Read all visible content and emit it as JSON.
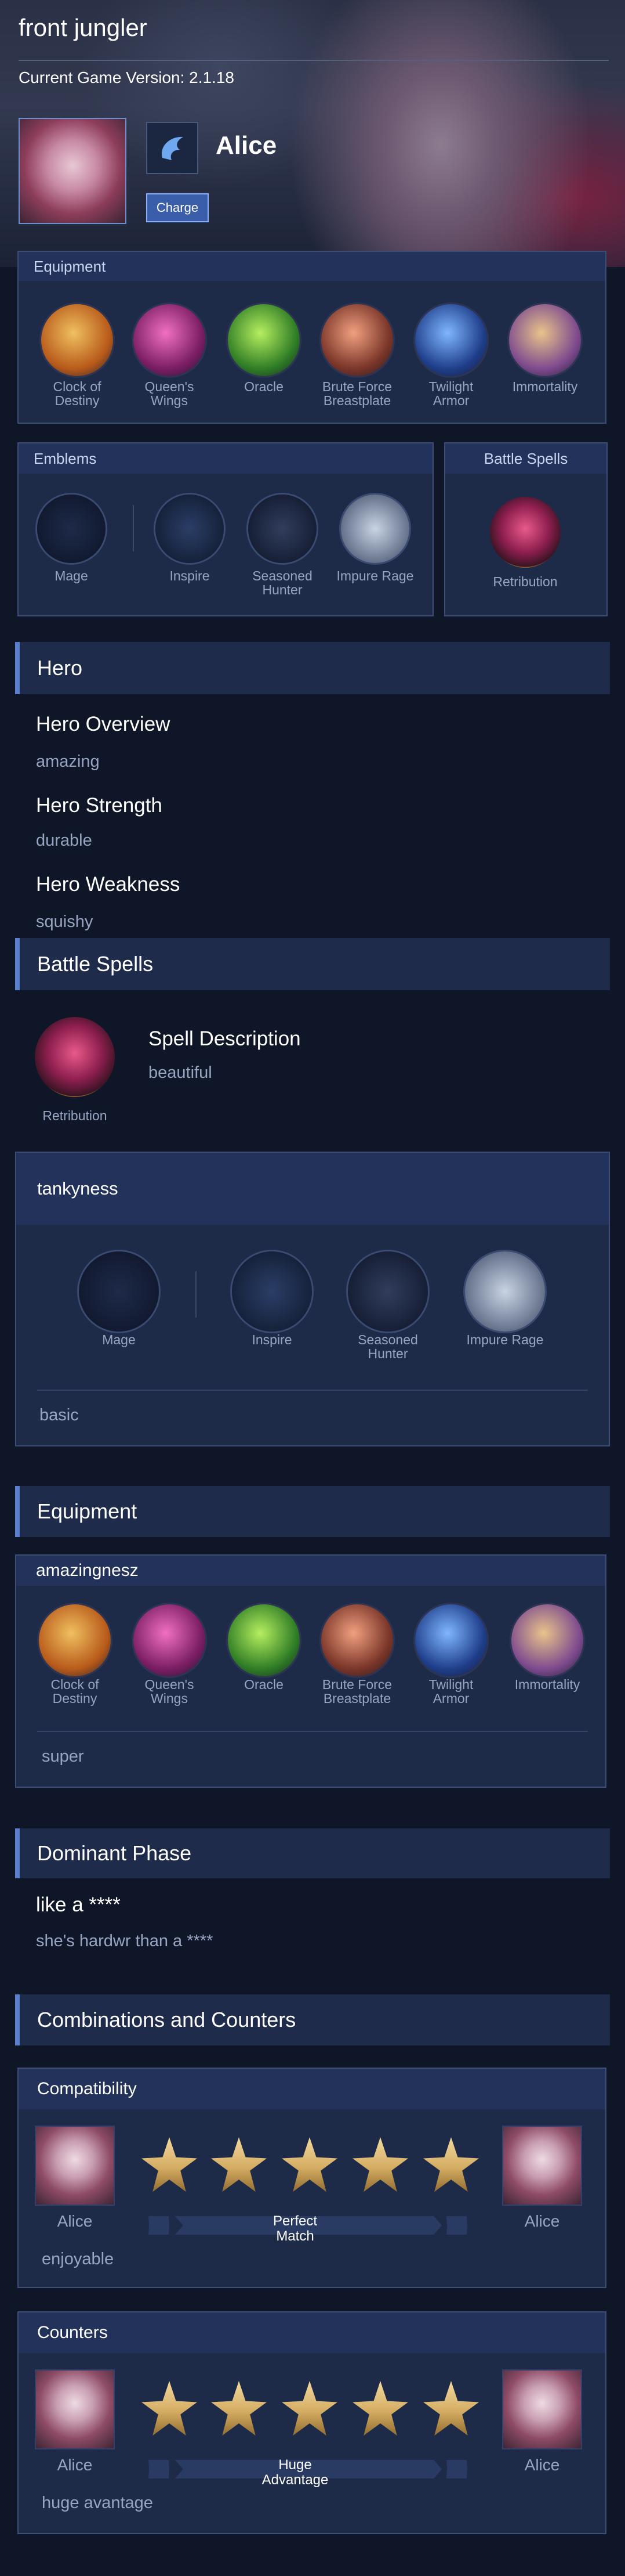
{
  "header": {
    "title": "front jungler",
    "version": "Current Game Version: 2.1.18",
    "hero_name": "Alice",
    "charge_label": "Charge"
  },
  "equipment_top": {
    "title": "Equipment",
    "items": [
      {
        "name": "Clock of\nDestiny",
        "color": "#d48a2a"
      },
      {
        "name": "Queen's\nWings",
        "color": "#c23a8e"
      },
      {
        "name": "Oracle",
        "color": "#5aa83a"
      },
      {
        "name": "Brute Force\nBreastplate",
        "color": "#b9593e"
      },
      {
        "name": "Twilight\nArmor",
        "color": "#3e6fc9"
      },
      {
        "name": "Immortality",
        "color": "#9a6fb0"
      }
    ]
  },
  "emblems_top": {
    "title": "Emblems",
    "items": [
      {
        "name": "Mage"
      },
      {
        "name": "Inspire"
      },
      {
        "name": "Seasoned\nHunter"
      },
      {
        "name": "Impure Rage"
      }
    ]
  },
  "battle_spells_top": {
    "title": "Battle Spells",
    "spell": "Retribution"
  },
  "hero_section": {
    "title": "Hero",
    "overview_title": "Hero Overview",
    "overview": "amazing",
    "strength_title": "Hero Strength",
    "strength": "durable",
    "weakness_title": "Hero Weakness",
    "weakness": "squishy"
  },
  "spell_section": {
    "title": "Battle Spells",
    "spell_name": "Retribution",
    "desc_title": "Spell Description",
    "desc": "beautiful"
  },
  "emblem_section": {
    "title": "tankyness",
    "items": [
      {
        "name": "Mage"
      },
      {
        "name": "Inspire"
      },
      {
        "name": "Seasoned\nHunter"
      },
      {
        "name": "Impure Rage"
      }
    ],
    "note": "basic"
  },
  "equipment_section": {
    "title": "Equipment",
    "subtitle": "amazingnesz",
    "items": [
      {
        "name": "Clock of\nDestiny"
      },
      {
        "name": "Queen's\nWings"
      },
      {
        "name": "Oracle"
      },
      {
        "name": "Brute Force\nBreastplate"
      },
      {
        "name": "Twilight\nArmor"
      },
      {
        "name": "Immortality"
      }
    ],
    "note": "super"
  },
  "phase_section": {
    "title": "Dominant Phase",
    "heading": "like a ****",
    "text": "she's hardwr than a ****"
  },
  "combo_section": {
    "title": "Combinations and Counters",
    "compatibility": {
      "title": "Compatibility",
      "left": "Alice",
      "right": "Alice",
      "stars": 5,
      "verdict": "Perfect\nMatch",
      "note": "enjoyable"
    },
    "counters": {
      "title": "Counters",
      "left": "Alice",
      "right": "Alice",
      "stars": 5,
      "verdict": "Huge\nAdvantage",
      "note": "huge avantage"
    }
  }
}
